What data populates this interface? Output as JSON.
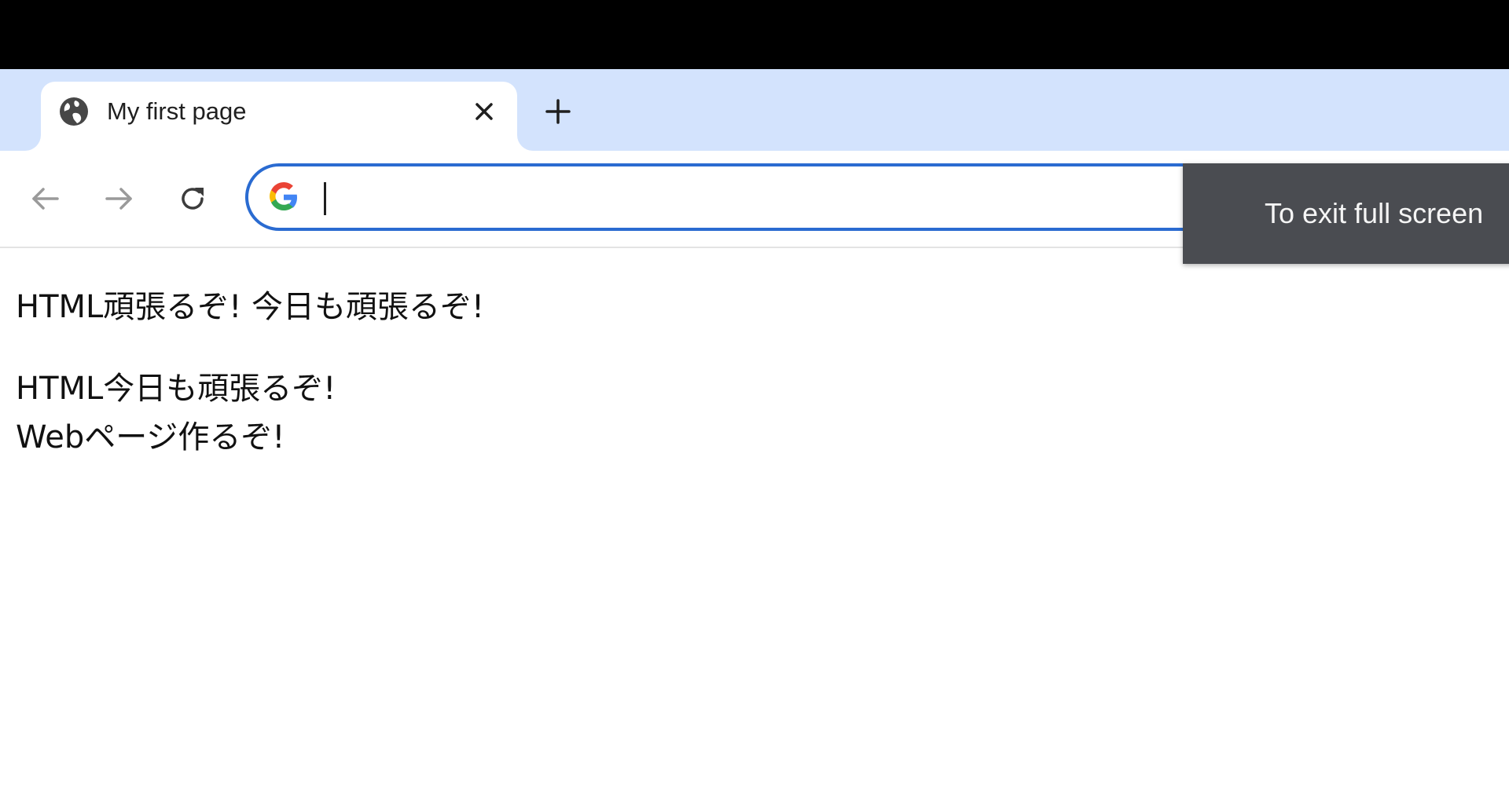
{
  "tab": {
    "title": "My first page",
    "favicon": "globe-icon",
    "close_icon": "close-icon",
    "new_tab_icon": "plus-icon"
  },
  "toolbar": {
    "back_icon": "back-arrow-icon",
    "forward_icon": "forward-arrow-icon",
    "reload_icon": "reload-icon",
    "omnibox": {
      "value": "",
      "provider_icon": "google-g-icon"
    }
  },
  "fullscreen_toast": {
    "text": "To exit full screen"
  },
  "page": {
    "paragraph1": "HTML頑張るぞ! 今日も頑張るぞ!",
    "paragraph2_line1": "HTML今日も頑張るぞ!",
    "paragraph2_line2": "Webページ作るぞ!"
  },
  "colors": {
    "tabstrip_bg": "#d3e3fd",
    "omnibox_border": "#2a6bd1",
    "toast_bg": "#4a4c51"
  }
}
